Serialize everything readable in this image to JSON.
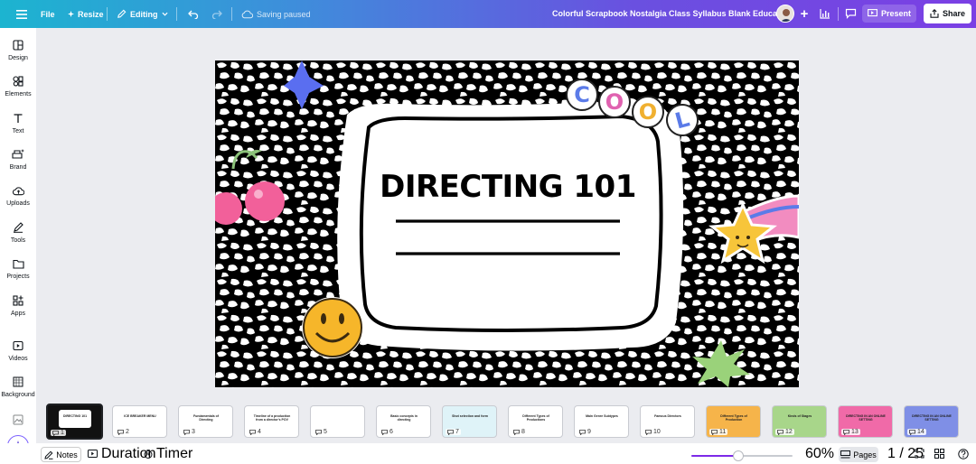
{
  "topbar": {
    "file_label": "File",
    "resize_label": "Resize",
    "editing_label": "Editing",
    "saving_status": "Saving paused",
    "document_title": "Colorful Scrapbook Nostalgia Class Syllabus Blank Educatio...",
    "present_label": "Present",
    "share_label": "Share"
  },
  "sidebar": {
    "items": [
      {
        "label": "Design",
        "icon": "design-icon"
      },
      {
        "label": "Elements",
        "icon": "elements-icon"
      },
      {
        "label": "Text",
        "icon": "text-icon"
      },
      {
        "label": "Brand",
        "icon": "brand-icon"
      },
      {
        "label": "Uploads",
        "icon": "uploads-icon"
      },
      {
        "label": "Tools",
        "icon": "tools-icon"
      },
      {
        "label": "Projects",
        "icon": "projects-icon"
      },
      {
        "label": "Apps",
        "icon": "apps-icon"
      },
      {
        "label": "Videos",
        "icon": "videos-icon"
      },
      {
        "label": "Background",
        "icon": "background-icon"
      }
    ]
  },
  "slide": {
    "title": "DIRECTING 101",
    "sticker_letters": [
      "C",
      "O",
      "O",
      "L"
    ],
    "sticker_letter_colors": [
      "#5b7be8",
      "#e062b0",
      "#f0b030",
      "#5b7be8"
    ]
  },
  "thumbnails": [
    {
      "number": "1",
      "title": "DIRECTING 101",
      "bg": "#ffffff"
    },
    {
      "number": "2",
      "title": "ICE BREAKER MENU",
      "bg": "#ffffff"
    },
    {
      "number": "3",
      "title": "Fundamentals of Directing",
      "bg": "#ffffff"
    },
    {
      "number": "4",
      "title": "Timeline of a production from a director's POV",
      "bg": "#ffffff"
    },
    {
      "number": "5",
      "title": "",
      "bg": "#ffffff"
    },
    {
      "number": "6",
      "title": "Basic concepts in directing",
      "bg": "#ffffff"
    },
    {
      "number": "7",
      "title": "Shot selection and form",
      "bg": "#dff3f8"
    },
    {
      "number": "8",
      "title": "Different Types of Productions",
      "bg": "#ffffff"
    },
    {
      "number": "9",
      "title": "Main Genre Subtypes",
      "bg": "#ffffff"
    },
    {
      "number": "10",
      "title": "Famous Directors",
      "bg": "#ffffff"
    },
    {
      "number": "11",
      "title": "Different Types of Production",
      "bg": "#f6b44a"
    },
    {
      "number": "12",
      "title": "Kinds of Stages",
      "bg": "#a8d68a"
    },
    {
      "number": "13",
      "title": "DIRECTING IN AN ONLINE SETTING",
      "bg": "#f06aa8"
    },
    {
      "number": "14",
      "title": "DIRECTING IN AN ONLINE SETTING",
      "bg": "#7f8fe6"
    }
  ],
  "bottombar": {
    "notes_label": "Notes",
    "duration_label": "Duration",
    "timer_label": "Timer",
    "zoom_percent": "60%",
    "zoom_level": 0.46,
    "pages_label": "Pages",
    "page_indicator": "1 / 25"
  },
  "colors": {
    "accent": "#7d2ae8",
    "topbar_gradient_start": "#1cb4d0",
    "topbar_gradient_end": "#7b3fe4"
  }
}
